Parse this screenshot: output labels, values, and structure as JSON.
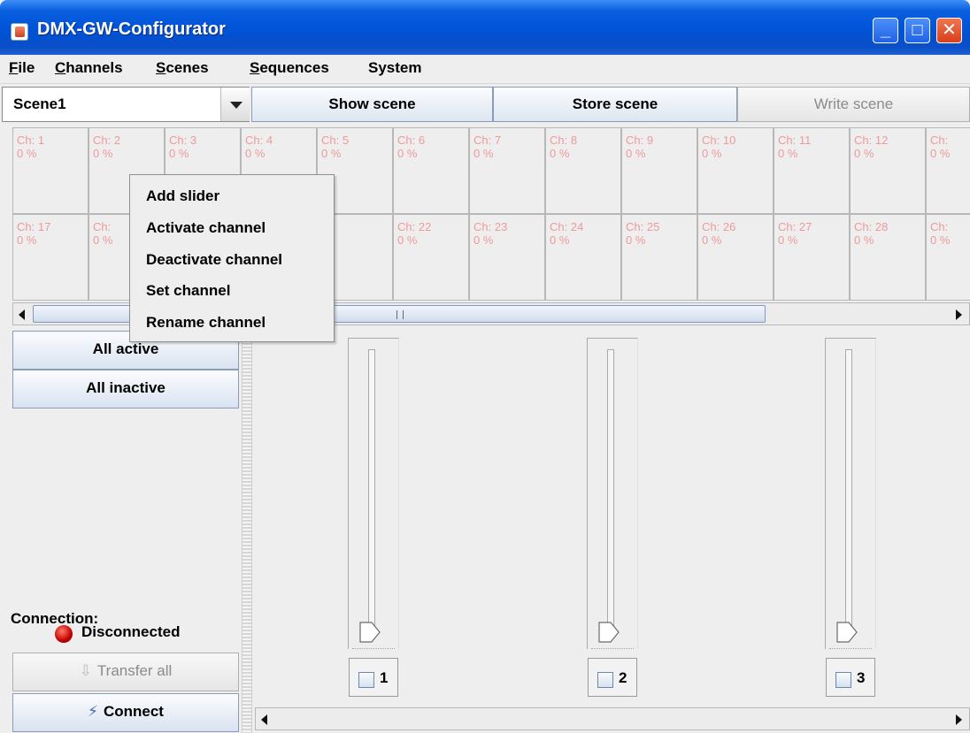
{
  "window": {
    "title": "DMX-GW-Configurator"
  },
  "menu": [
    {
      "label": "File",
      "u": "F",
      "rest": "ile"
    },
    {
      "label": "Channels",
      "u": "C",
      "rest": "hannels"
    },
    {
      "label": "Scenes",
      "u": "S",
      "rest": "cenes"
    },
    {
      "label": "Sequences",
      "u": "S",
      "rest": "equences"
    },
    {
      "label": "System",
      "u": "",
      "rest": "System"
    }
  ],
  "toolbar": {
    "scene_selected": "Scene1",
    "show_scene": "Show scene",
    "store_scene": "Store scene",
    "write_scene": "Write scene"
  },
  "channels_row1": [
    {
      "name": "Ch: 1",
      "value": "0 %"
    },
    {
      "name": "Ch: 2",
      "value": "0 %"
    },
    {
      "name": "Ch: 3",
      "value": "0 %"
    },
    {
      "name": "Ch: 4",
      "value": "0 %"
    },
    {
      "name": "Ch: 5",
      "value": "0 %"
    },
    {
      "name": "Ch: 6",
      "value": "0 %"
    },
    {
      "name": "Ch: 7",
      "value": "0 %"
    },
    {
      "name": "Ch: 8",
      "value": "0 %"
    },
    {
      "name": "Ch: 9",
      "value": "0 %"
    },
    {
      "name": "Ch: 10",
      "value": "0 %"
    },
    {
      "name": "Ch: 11",
      "value": "0 %"
    },
    {
      "name": "Ch: 12",
      "value": "0 %"
    },
    {
      "name": "Ch:",
      "value": "0 %"
    }
  ],
  "channels_row2": [
    {
      "name": "Ch: 17",
      "value": "0 %"
    },
    {
      "name": "Ch:",
      "value": "0 %"
    },
    {
      "name": "",
      "value": ""
    },
    {
      "name": "h: 21",
      "value": "%"
    },
    {
      "name": "",
      "value": ""
    },
    {
      "name": "Ch: 22",
      "value": "0 %"
    },
    {
      "name": "Ch: 23",
      "value": "0 %"
    },
    {
      "name": "Ch: 24",
      "value": "0 %"
    },
    {
      "name": "Ch: 25",
      "value": "0 %"
    },
    {
      "name": "Ch: 26",
      "value": "0 %"
    },
    {
      "name": "Ch: 27",
      "value": "0 %"
    },
    {
      "name": "Ch: 28",
      "value": "0 %"
    },
    {
      "name": "Ch:",
      "value": "0 %"
    }
  ],
  "context_menu": [
    "Add slider",
    "Activate channel",
    "Deactivate channel",
    "Set channel",
    "Rename channel"
  ],
  "left_panel": {
    "all_active": "All active",
    "all_inactive": "All inactive",
    "connection_label": "Connection:",
    "status": "Disconnected",
    "transfer_all": "Transfer all",
    "connect": "Connect"
  },
  "sliders": [
    {
      "number": "1",
      "level": 0
    },
    {
      "number": "2",
      "level": 0
    },
    {
      "number": "3",
      "level": 0
    }
  ],
  "colors": {
    "title_bar": "#0052d6",
    "channel_text": "#ee9a9a",
    "status_red": "#c10000"
  }
}
